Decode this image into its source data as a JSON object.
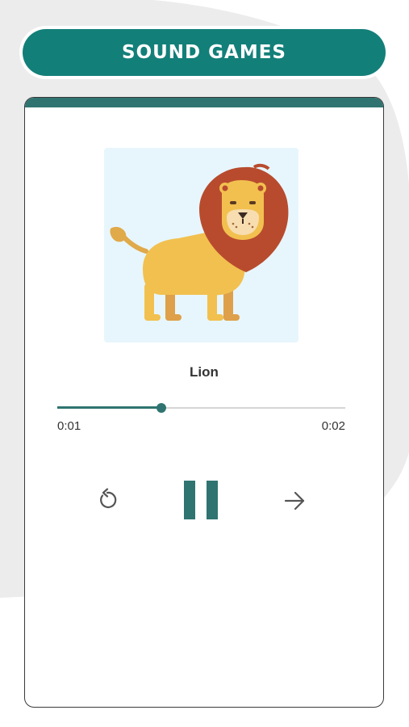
{
  "header": {
    "title": "SOUND GAMES"
  },
  "player": {
    "track_name": "Lion",
    "current_time": "0:01",
    "total_time": "0:02",
    "progress": 0.36
  },
  "controls": {
    "replay": "replay-icon",
    "pause": "pause-icon",
    "next": "arrow-right-icon"
  },
  "colors": {
    "brand": "#137f79",
    "accent": "#2f7470",
    "background_blob": "#ececec"
  }
}
